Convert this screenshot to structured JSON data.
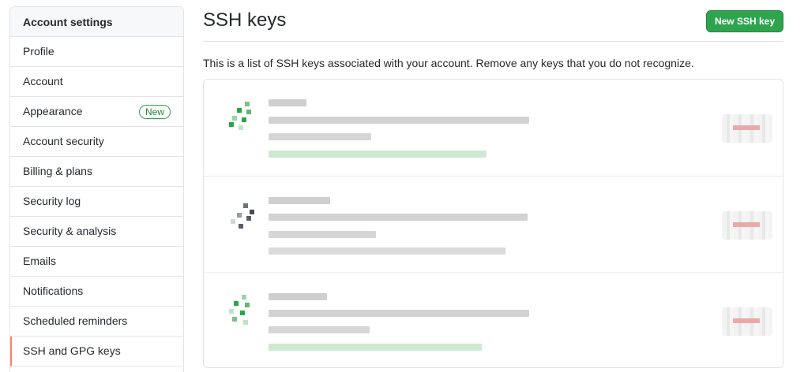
{
  "sidebar": {
    "header": "Account settings",
    "items": [
      {
        "label": "Profile"
      },
      {
        "label": "Account"
      },
      {
        "label": "Appearance",
        "badge": "New"
      },
      {
        "label": "Account security"
      },
      {
        "label": "Billing & plans"
      },
      {
        "label": "Security log"
      },
      {
        "label": "Security & analysis"
      },
      {
        "label": "Emails"
      },
      {
        "label": "Notifications"
      },
      {
        "label": "Scheduled reminders"
      },
      {
        "label": "SSH and GPG keys",
        "selected": true
      }
    ]
  },
  "main": {
    "title": "SSH keys",
    "new_button": "New SSH key",
    "description": "This is a list of SSH keys associated with your account. Remove any keys that you do not recognize.",
    "keys_note": "Key entries are pixelated/redacted in the screenshot",
    "colors": {
      "primary_button": "#2ea44f",
      "selected_accent": "#f9826c",
      "badge_green": "#28a745",
      "key_icon_green": "#28a745",
      "redacted_red": "#e7a2a2"
    }
  }
}
